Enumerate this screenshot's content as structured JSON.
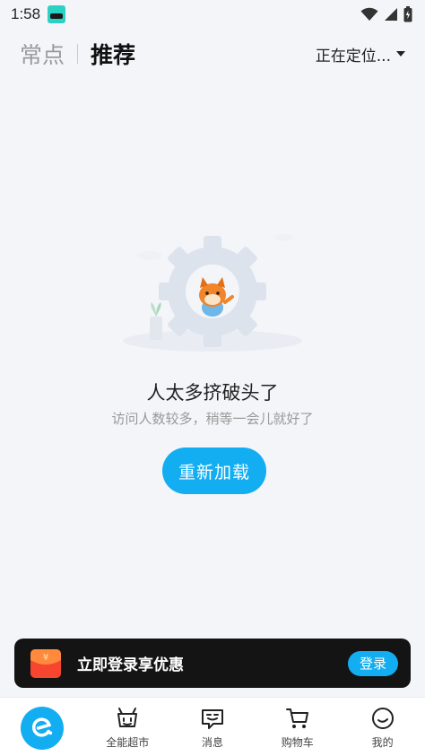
{
  "status_bar": {
    "time": "1:58",
    "icons": [
      "app-notification-icon",
      "wifi-icon",
      "signal-icon",
      "battery-icon"
    ]
  },
  "header": {
    "tab_inactive": "常点",
    "tab_active": "推荐",
    "location": "正在定位..."
  },
  "empty_state": {
    "title": "人太多挤破头了",
    "subtitle": "访问人数较多，稍等一会儿就好了",
    "reload_button": "重新加载"
  },
  "login_banner": {
    "coupon_symbol": "¥",
    "text": "立即登录享优惠",
    "button": "登录"
  },
  "bottom_nav": {
    "items": [
      {
        "label": "",
        "icon": "eleme-logo-icon"
      },
      {
        "label": "全能超市",
        "icon": "supermarket-icon"
      },
      {
        "label": "消息",
        "icon": "message-icon"
      },
      {
        "label": "购物车",
        "icon": "cart-icon"
      },
      {
        "label": "我的",
        "icon": "profile-icon"
      }
    ]
  },
  "colors": {
    "accent": "#12aef1",
    "background": "#f3f5f9",
    "banner_bg": "#141414"
  }
}
